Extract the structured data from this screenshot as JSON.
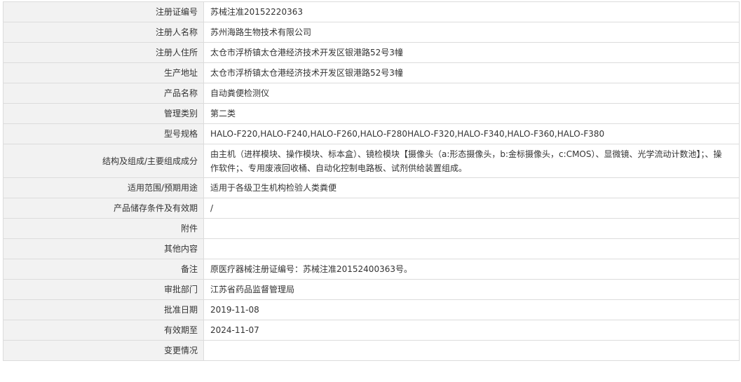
{
  "rows": [
    {
      "label": "注册证编号",
      "value": "苏械注准20152220363"
    },
    {
      "label": "注册人名称",
      "value": "苏州海路生物技术有限公司"
    },
    {
      "label": "注册人住所",
      "value": "太仓市浮桥镇太仓港经济技术开发区银港路52号3幢"
    },
    {
      "label": "生产地址",
      "value": "太仓市浮桥镇太仓港经济技术开发区银港路52号3幢"
    },
    {
      "label": "产品名称",
      "value": "自动粪便检测仪"
    },
    {
      "label": "管理类别",
      "value": "第二类"
    },
    {
      "label": "型号规格",
      "value": "HALO-F220,HALO-F240,HALO-F260,HALO-F280HALO-F320,HALO-F340,HALO-F360,HALO-F380"
    },
    {
      "label": "结构及组成/主要组成成分",
      "value": "由主机（进样模块、操作模块、标本盒）、镜检模块【摄像头（a:形态摄像头，b:金标摄像头，c:CMOS）、显微镜、光学流动计数池】；、操作软件；、专用废液回收桶、自动化控制电路板、试剂供给装置组成。"
    },
    {
      "label": "适用范围/预期用途",
      "value": "适用于各级卫生机构检验人类粪便"
    },
    {
      "label": "产品储存条件及有效期",
      "value": "/"
    },
    {
      "label": "附件",
      "value": ""
    },
    {
      "label": "其他内容",
      "value": ""
    },
    {
      "label": "备注",
      "value": "原医疗器械注册证编号：苏械注准20152400363号。"
    },
    {
      "label": "审批部门",
      "value": "江苏省药品监督管理局"
    },
    {
      "label": "批准日期",
      "value": "2019-11-08"
    },
    {
      "label": "有效期至",
      "value": "2024-11-07"
    },
    {
      "label": "变更情况",
      "value": ""
    }
  ]
}
